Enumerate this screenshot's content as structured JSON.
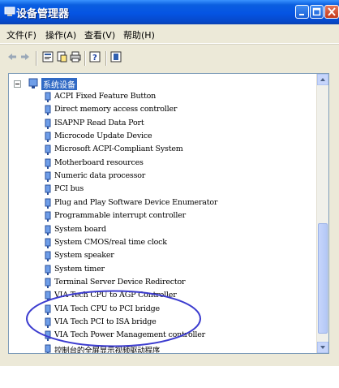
{
  "window": {
    "title": "设备管理器",
    "colors": {
      "titlebar": "#0554e3",
      "selection": "#316ac5",
      "highlight_circle": "#3c3ccf"
    }
  },
  "menu": {
    "items": [
      {
        "label": "文件(F)"
      },
      {
        "label": "操作(A)"
      },
      {
        "label": "查看(V)"
      },
      {
        "label": "帮助(H)"
      }
    ]
  },
  "toolbar": {
    "icons": [
      "back-arrow-icon",
      "forward-arrow-icon",
      "properties-icon",
      "refresh-icon",
      "print-icon",
      "help-icon",
      "scan-hardware-icon"
    ]
  },
  "tree": {
    "root": {
      "label": "系统设备",
      "expanded": true,
      "selected": true
    },
    "items": [
      {
        "label": "ACPI Fixed Feature Button"
      },
      {
        "label": "Direct memory access controller"
      },
      {
        "label": "ISAPNP Read Data Port"
      },
      {
        "label": "Microcode Update Device"
      },
      {
        "label": "Microsoft ACPI-Compliant System"
      },
      {
        "label": "Motherboard resources"
      },
      {
        "label": "Numeric data processor"
      },
      {
        "label": "PCI bus"
      },
      {
        "label": "Plug and Play Software Device Enumerator"
      },
      {
        "label": "Programmable interrupt controller"
      },
      {
        "label": "System board"
      },
      {
        "label": "System CMOS/real time clock"
      },
      {
        "label": "System speaker"
      },
      {
        "label": "System timer"
      },
      {
        "label": "Terminal Server Device Redirector"
      },
      {
        "label": "VIA Tech CPU to AGP Controller"
      },
      {
        "label": "VIA Tech CPU to PCI bridge"
      },
      {
        "label": "VIA Tech PCI to ISA bridge"
      },
      {
        "label": "VIA Tech Power Management controller"
      },
      {
        "label": "控制台的全屏显示视频驱动程序"
      }
    ]
  }
}
